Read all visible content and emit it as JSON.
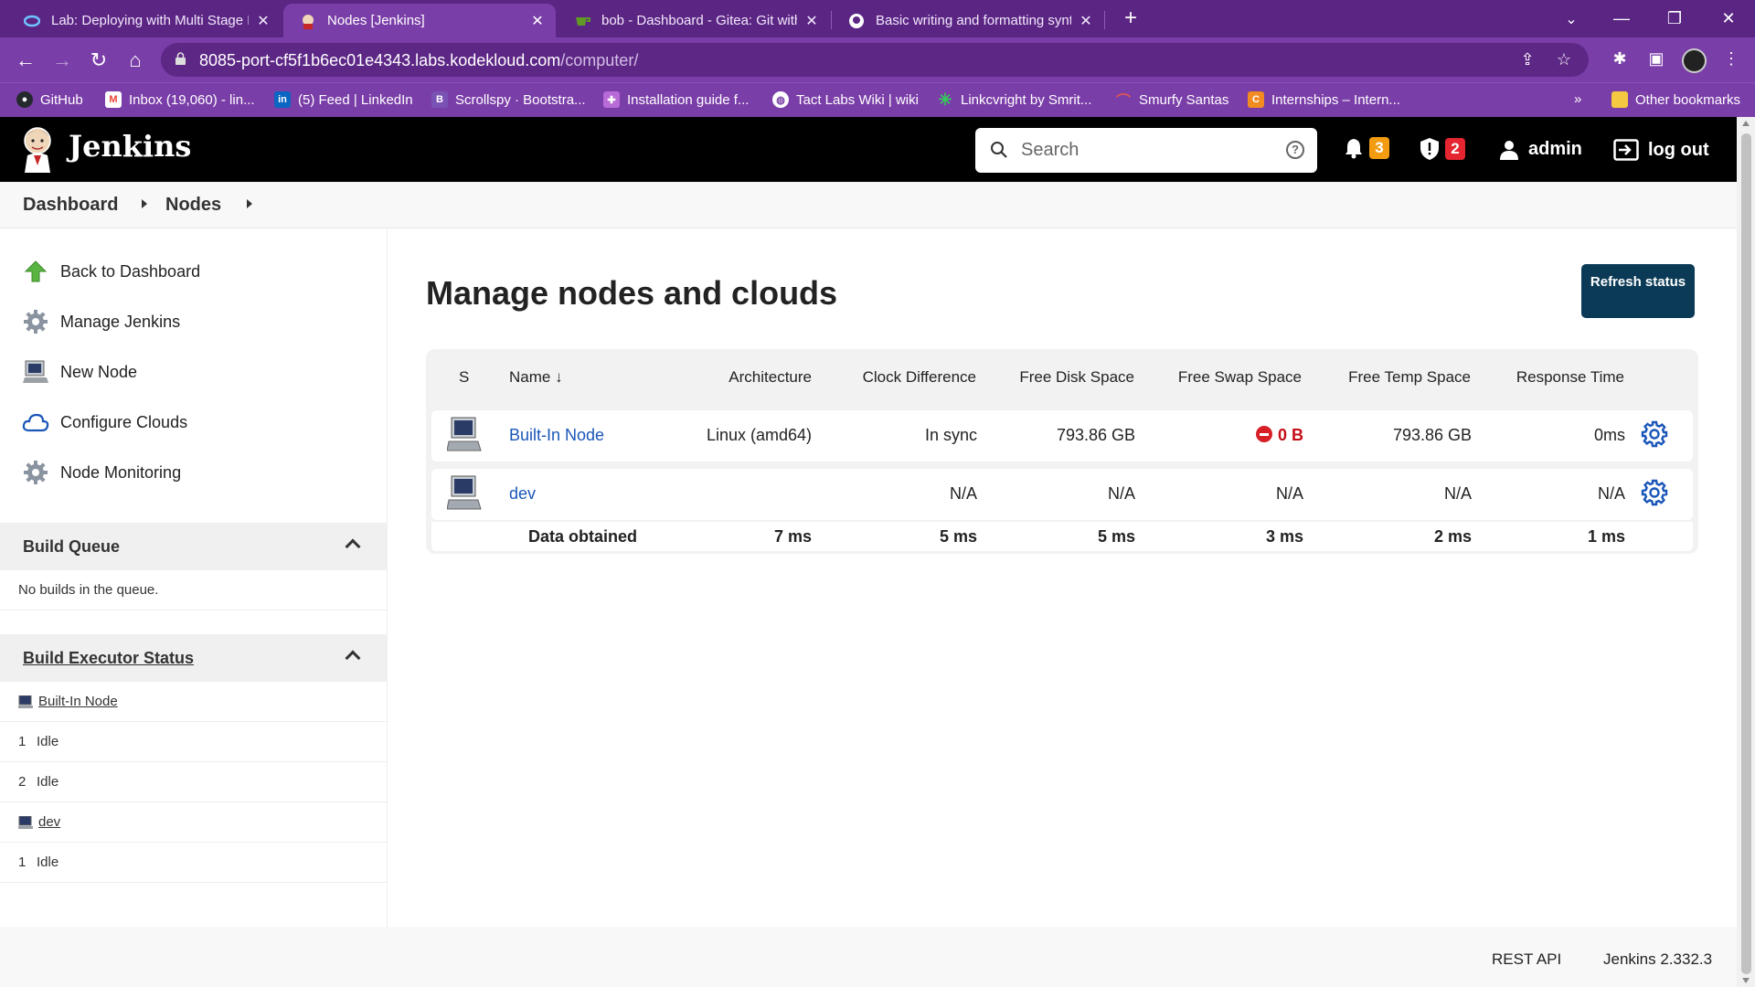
{
  "browser": {
    "tabs": [
      {
        "title": "Lab: Deploying with Multi Stage Pi",
        "icon": "kodekloud-icon"
      },
      {
        "title": "Nodes [Jenkins]",
        "icon": "jenkins-icon",
        "active": true
      },
      {
        "title": "bob - Dashboard - Gitea: Git with",
        "icon": "gitea-icon"
      },
      {
        "title": "Basic writing and formatting synt",
        "icon": "github-icon"
      }
    ],
    "url_host": "8085-port-cf5f1b6ec01e4343.labs.kodekloud.com",
    "url_path": "/computer/",
    "bookmarks": [
      {
        "label": "GitHub",
        "icon": "github-icon",
        "color": "#24292e"
      },
      {
        "label": "Inbox (19,060) - lin...",
        "icon": "gmail-icon",
        "color": "#ea4335"
      },
      {
        "label": "(5) Feed | LinkedIn",
        "icon": "linkedin-icon",
        "color": "#0a66c2"
      },
      {
        "label": "Scrollspy · Bootstra...",
        "icon": "bootstrap-icon",
        "color": "#7952b3"
      },
      {
        "label": "Installation guide f...",
        "icon": "puzzle-icon",
        "color": "#b86ad6"
      },
      {
        "label": "Tact Labs Wiki | wiki",
        "icon": "globe-icon",
        "color": "#ffffff"
      },
      {
        "label": "Linkcvright by Smrit...",
        "icon": "asterisk-icon",
        "color": "#37c95a"
      },
      {
        "label": "Smurfy Santas",
        "icon": "rainbow-icon",
        "color": "#e05555"
      },
      {
        "label": "Internships – Intern...",
        "icon": "internshala-icon",
        "color": "#f28b22"
      }
    ],
    "bookmarks_more": "»",
    "other_bookmarks": "Other bookmarks"
  },
  "header": {
    "title": "Jenkins",
    "search_placeholder": "Search",
    "notifications_count": "3",
    "security_count": "2",
    "user": "admin",
    "logout": "log out",
    "colors": {
      "notification_badge": "#f39c12",
      "security_badge": "#e5252f"
    }
  },
  "breadcrumb": [
    "Dashboard",
    "Nodes"
  ],
  "sidebar": {
    "tasks": [
      {
        "label": "Back to Dashboard",
        "icon": "up-arrow-icon"
      },
      {
        "label": "Manage Jenkins",
        "icon": "gear-icon"
      },
      {
        "label": "New Node",
        "icon": "computer-icon"
      },
      {
        "label": "Configure Clouds",
        "icon": "cloud-icon"
      },
      {
        "label": "Node Monitoring",
        "icon": "gear-icon"
      }
    ],
    "build_queue": {
      "title": "Build Queue",
      "empty": "No builds in the queue."
    },
    "executor_status": {
      "title": "Build Executor Status",
      "nodes": [
        {
          "name": "Built-In Node",
          "executors": [
            {
              "num": "1",
              "state": "Idle"
            },
            {
              "num": "2",
              "state": "Idle"
            }
          ]
        },
        {
          "name": "dev",
          "executors": [
            {
              "num": "1",
              "state": "Idle"
            }
          ]
        }
      ]
    }
  },
  "main": {
    "title": "Manage nodes and clouds",
    "refresh_button": "Refresh status",
    "columns": [
      "S",
      "Name ↓",
      "Architecture",
      "Clock Difference",
      "Free Disk Space",
      "Free Swap Space",
      "Free Temp Space",
      "Response Time"
    ],
    "rows": [
      {
        "name": "Built-In Node",
        "architecture": "Linux (amd64)",
        "clock": "In sync",
        "disk": "793.86 GB",
        "swap": "0 B",
        "temp": "793.86 GB",
        "response": "0ms"
      },
      {
        "name": "dev",
        "architecture": "",
        "clock": "N/A",
        "disk": "N/A",
        "swap": "N/A",
        "temp": "N/A",
        "response": "N/A"
      }
    ],
    "data_obtained": {
      "label": "Data obtained",
      "architecture": "7 ms",
      "clock": "5 ms",
      "disk": "5 ms",
      "swap": "3 ms",
      "temp": "2 ms",
      "response": "1 ms"
    }
  },
  "footer": {
    "rest_api": "REST API",
    "version": "Jenkins 2.332.3"
  }
}
